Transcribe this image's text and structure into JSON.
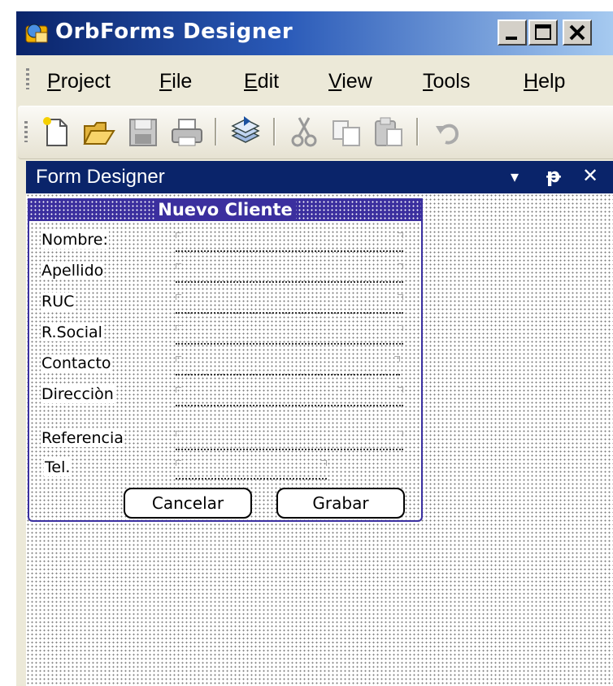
{
  "window": {
    "title": "OrbForms Designer",
    "controls": [
      "minimize",
      "maximize",
      "close"
    ]
  },
  "menu": [
    {
      "label": "Project",
      "underline": "P",
      "rest": "roject"
    },
    {
      "label": "File",
      "underline": "F",
      "rest": "ile"
    },
    {
      "label": "Edit",
      "underline": "E",
      "rest": "dit"
    },
    {
      "label": "View",
      "underline": "V",
      "rest": "iew"
    },
    {
      "label": "Tools",
      "underline": "T",
      "rest": "ools"
    },
    {
      "label": "Help",
      "underline": "H",
      "rest": "elp"
    }
  ],
  "toolbar": {
    "buttons": [
      "new-icon",
      "open-icon",
      "save-icon",
      "print-icon",
      "build-icon",
      "cut-icon",
      "copy-icon",
      "paste-icon",
      "undo-icon"
    ]
  },
  "panel": {
    "title": "Form Designer",
    "dropdown_glyph": "▾",
    "pin_glyph": "ᵽ",
    "close_glyph": "✕"
  },
  "form": {
    "title": "Nuevo Cliente",
    "fields": [
      {
        "label": "Nombre:"
      },
      {
        "label": "Apellido"
      },
      {
        "label": "RUC"
      },
      {
        "label": "R.Social"
      },
      {
        "label": "Contacto"
      },
      {
        "label": "Direcciòn"
      },
      {
        "label": "Referencia"
      },
      {
        "label": "Tel."
      }
    ],
    "buttons": {
      "cancel": "Cancelar",
      "save": "Grabar"
    }
  },
  "colors": {
    "titlebar": "#0a246a",
    "panel_header": "#0a246a",
    "form_border": "#3a2fa0",
    "chrome": "#ece9d8"
  }
}
